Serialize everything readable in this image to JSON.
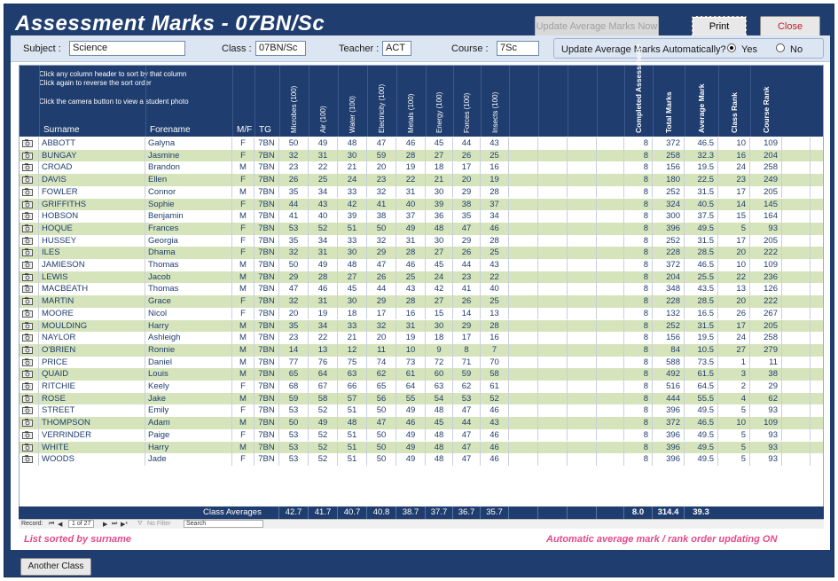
{
  "window": {
    "title": "Assessment Marks - 07BN/Sc",
    "update_now_label": "Update Average Marks Now",
    "print_label": "Print",
    "close_label": "Close"
  },
  "filters": {
    "subject_label": "Subject :",
    "subject_value": "Science",
    "class_label": "Class :",
    "class_value": "07BN/Sc",
    "teacher_label": "Teacher :",
    "teacher_value": "ACT",
    "course_label": "Course :",
    "course_value": "7Sc",
    "auto_update_label": "Update Average Marks Automatically?",
    "yes_label": "Yes",
    "no_label": "No",
    "auto_update_selected": "Yes"
  },
  "grid": {
    "hint_line1": "Click any column header to sort by that column",
    "hint_line2": "Click again to reverse the sort order",
    "hint_line3": "Click the camera button to view a student photo",
    "columns": {
      "surname": "Surname",
      "forename": "Forename",
      "mf": "M/F",
      "tg": "TG",
      "subjects": [
        "Microbes (100)",
        "Air (100)",
        "Water (100)",
        "Electricity (100)",
        "Metals (100)",
        "Energy (100)",
        "Forces (100)",
        "Insects (100)"
      ],
      "completed": "Completed Assessments",
      "total": "Total Marks",
      "average": "Average Mark",
      "class_rank": "Class Rank",
      "course_rank": "Course Rank"
    },
    "rows": [
      [
        "ABBOTT",
        "Galyna",
        "F",
        "7BN",
        50,
        49,
        48,
        47,
        46,
        45,
        44,
        43,
        8,
        372,
        "46.5",
        10,
        109
      ],
      [
        "BUNGAY",
        "Jasmine",
        "F",
        "7BN",
        32,
        31,
        30,
        59,
        28,
        27,
        26,
        25,
        8,
        258,
        "32.3",
        16,
        204
      ],
      [
        "CROAD",
        "Brandon",
        "M",
        "7BN",
        23,
        22,
        21,
        20,
        19,
        18,
        17,
        16,
        8,
        156,
        "19.5",
        24,
        258
      ],
      [
        "DAVIS",
        "Ellen",
        "F",
        "7BN",
        26,
        25,
        24,
        23,
        22,
        21,
        20,
        19,
        8,
        180,
        "22.5",
        23,
        249
      ],
      [
        "FOWLER",
        "Connor",
        "M",
        "7BN",
        35,
        34,
        33,
        32,
        31,
        30,
        29,
        28,
        8,
        252,
        "31.5",
        17,
        205
      ],
      [
        "GRIFFITHS",
        "Sophie",
        "F",
        "7BN",
        44,
        43,
        42,
        41,
        40,
        39,
        38,
        37,
        8,
        324,
        "40.5",
        14,
        145
      ],
      [
        "HOBSON",
        "Benjamin",
        "M",
        "7BN",
        41,
        40,
        39,
        38,
        37,
        36,
        35,
        34,
        8,
        300,
        "37.5",
        15,
        164
      ],
      [
        "HOQUE",
        "Frances",
        "F",
        "7BN",
        53,
        52,
        51,
        50,
        49,
        48,
        47,
        46,
        8,
        396,
        "49.5",
        5,
        93
      ],
      [
        "HUSSEY",
        "Georgia",
        "F",
        "7BN",
        35,
        34,
        33,
        32,
        31,
        30,
        29,
        28,
        8,
        252,
        "31.5",
        17,
        205
      ],
      [
        "ILES",
        "Dhama",
        "F",
        "7BN",
        32,
        31,
        30,
        29,
        28,
        27,
        26,
        25,
        8,
        228,
        "28.5",
        20,
        222
      ],
      [
        "JAMIESON",
        "Thomas",
        "M",
        "7BN",
        50,
        49,
        48,
        47,
        46,
        45,
        44,
        43,
        8,
        372,
        "46.5",
        10,
        109
      ],
      [
        "LEWIS",
        "Jacob",
        "M",
        "7BN",
        29,
        28,
        27,
        26,
        25,
        24,
        23,
        22,
        8,
        204,
        "25.5",
        22,
        236
      ],
      [
        "MACBEATH",
        "Thomas",
        "M",
        "7BN",
        47,
        46,
        45,
        44,
        43,
        42,
        41,
        40,
        8,
        348,
        "43.5",
        13,
        126
      ],
      [
        "MARTIN",
        "Grace",
        "F",
        "7BN",
        32,
        31,
        30,
        29,
        28,
        27,
        26,
        25,
        8,
        228,
        "28.5",
        20,
        222
      ],
      [
        "MOORE",
        "Nicol",
        "F",
        "7BN",
        20,
        19,
        18,
        17,
        16,
        15,
        14,
        13,
        8,
        132,
        "16.5",
        26,
        267
      ],
      [
        "MOULDING",
        "Harry",
        "M",
        "7BN",
        35,
        34,
        33,
        32,
        31,
        30,
        29,
        28,
        8,
        252,
        "31.5",
        17,
        205
      ],
      [
        "NAYLOR",
        "Ashleigh",
        "M",
        "7BN",
        23,
        22,
        21,
        20,
        19,
        18,
        17,
        16,
        8,
        156,
        "19.5",
        24,
        258
      ],
      [
        "O'BRIEN",
        "Ronnie",
        "M",
        "7BN",
        14,
        13,
        12,
        11,
        10,
        9,
        8,
        7,
        8,
        84,
        "10.5",
        27,
        279
      ],
      [
        "PRICE",
        "Daniel",
        "M",
        "7BN",
        77,
        76,
        75,
        74,
        73,
        72,
        71,
        70,
        8,
        588,
        "73.5",
        1,
        11
      ],
      [
        "QUAID",
        "Louis",
        "M",
        "7BN",
        65,
        64,
        63,
        62,
        61,
        60,
        59,
        58,
        8,
        492,
        "61.5",
        3,
        38
      ],
      [
        "RITCHIE",
        "Keely",
        "F",
        "7BN",
        68,
        67,
        66,
        65,
        64,
        63,
        62,
        61,
        8,
        516,
        "64.5",
        2,
        29
      ],
      [
        "ROSE",
        "Jake",
        "M",
        "7BN",
        59,
        58,
        57,
        56,
        55,
        54,
        53,
        52,
        8,
        444,
        "55.5",
        4,
        62
      ],
      [
        "STREET",
        "Emily",
        "F",
        "7BN",
        53,
        52,
        51,
        50,
        49,
        48,
        47,
        46,
        8,
        396,
        "49.5",
        5,
        93
      ],
      [
        "THOMPSON",
        "Adam",
        "M",
        "7BN",
        50,
        49,
        48,
        47,
        46,
        45,
        44,
        43,
        8,
        372,
        "46.5",
        10,
        109
      ],
      [
        "VERRINDER",
        "Paige",
        "F",
        "7BN",
        53,
        52,
        51,
        50,
        49,
        48,
        47,
        46,
        8,
        396,
        "49.5",
        5,
        93
      ],
      [
        "WHITE",
        "Harry",
        "M",
        "7BN",
        53,
        52,
        51,
        50,
        49,
        48,
        47,
        46,
        8,
        396,
        "49.5",
        5,
        93
      ],
      [
        "WOODS",
        "Jade",
        "F",
        "7BN",
        53,
        52,
        51,
        50,
        49,
        48,
        47,
        46,
        8,
        396,
        "49.5",
        5,
        93
      ]
    ]
  },
  "averages": {
    "label": "Class Averages",
    "subjects": [
      "42.7",
      "41.7",
      "40.7",
      "40.8",
      "38.7",
      "37.7",
      "36.7",
      "35.7"
    ],
    "completed": "8.0",
    "total": "314.4",
    "average": "39.3"
  },
  "navigator": {
    "record_label": "Record:",
    "position": "1 of 27",
    "no_filter_label": "No Filter",
    "search_label": "Search"
  },
  "status": {
    "sort_status": "List sorted by surname",
    "auto_status": "Automatic average mark / rank order updating ON"
  },
  "footer": {
    "another_class_label": "Another Class"
  },
  "colors": {
    "header_bg": "#1f3d6e",
    "alt_row": "#d6e4bc",
    "status_pink": "#e24a8a",
    "close_red": "#c0202c"
  }
}
